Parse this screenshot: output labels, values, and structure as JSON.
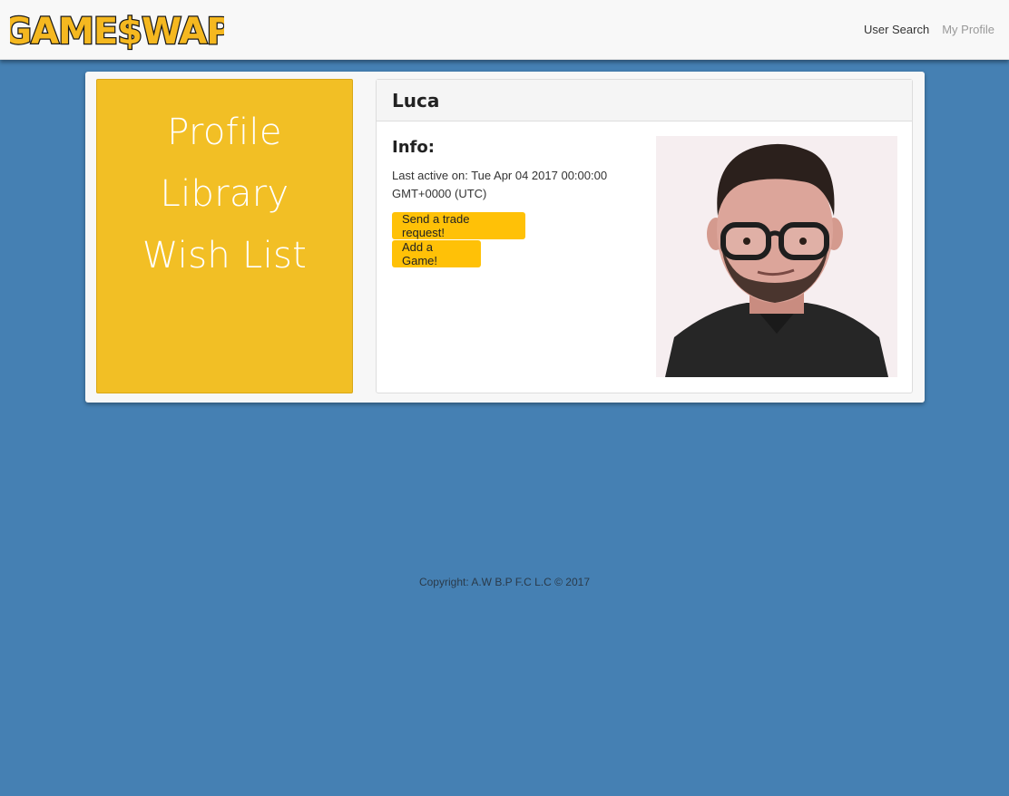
{
  "brand": {
    "logo_text": "GAME$WAP",
    "colors": {
      "fill": "#f5b820",
      "outline": "#1a1a1a"
    }
  },
  "nav": {
    "links": [
      {
        "label": "User Search",
        "active": true
      },
      {
        "label": "My Profile",
        "active": false
      }
    ]
  },
  "sidebar": {
    "items": [
      {
        "label": "Profile"
      },
      {
        "label": "Library"
      },
      {
        "label": "Wish List"
      }
    ],
    "color": "#f2bf25"
  },
  "profile": {
    "username": "Luca",
    "info_heading": "Info:",
    "last_active": "Last active on: Tue Apr 04 2017 00:00:00 GMT+0000 (UTC)",
    "avatar_icon": "user-photo",
    "buttons": {
      "trade": "Send a trade request!",
      "add_game": "Add a Game!"
    },
    "button_color": "#ffc107"
  },
  "footer": {
    "copyright": "Copyright: A.W B.P F.C L.C © 2017"
  },
  "colors": {
    "background": "#4580b3",
    "navbar": "#f8f8f8"
  }
}
